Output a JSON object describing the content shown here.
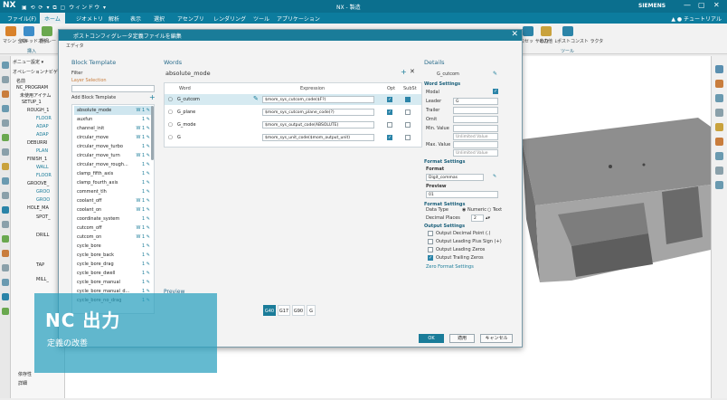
{
  "titlebar": {
    "app": "NX",
    "qat": "▣ ⟲ ⟳ ▾ ⧉ ▢ ウィンドウ ▾",
    "title": "NX - 製造",
    "brand": "SIEMENS",
    "controls": [
      "—",
      "▢",
      "✕"
    ]
  },
  "menubar": {
    "items": [
      "ファイル(F)",
      "ホーム",
      "ジオメトリ",
      "解析",
      "表示",
      "選択",
      "アセンブリ",
      "レンダリング",
      "ツール",
      "アプリケーション"
    ],
    "search": "▲ ● チュートリアル"
  },
  "ribbon": {
    "left": [
      "マシン\n全体",
      "スキッド\n選択",
      "オペレー\nション全体"
    ],
    "group_label": "挿入",
    "right": [
      "プロセッ\nサ出力",
      "その他\n↓",
      "ポストコンスト\nラクタ"
    ],
    "right_group": "ツール"
  },
  "navpanel": {
    "filter": "ボニュー設定 ▾",
    "title": "オペレーションナビゲータ",
    "col": "名前",
    "items": [
      "NC_PROGRAM",
      "未使用アイテム",
      "SETUP_1",
      "ROUGH_1",
      "FLOOR",
      "ADAP",
      "ADAP",
      "DEBURRI",
      "PLAN",
      "FINISH_1",
      "WALL",
      "FLOOR",
      "GROOVE_",
      "GROO",
      "GROO",
      "HOLE_MA",
      "SPOT_",
      "DRILL",
      "TAP",
      "MILL_"
    ],
    "bottom": [
      "依存性",
      "詳細"
    ]
  },
  "dialog": {
    "title": "ポストコンフィグレータ定義ファイルを編集",
    "editor": "エディタ",
    "block_template": {
      "heading": "Block Template",
      "filter_label": "Filter",
      "layer_label": "Layer Selection",
      "add_label": "Add Block Template",
      "items": [
        {
          "name": "absolute_mode",
          "w": "W 1 ✎"
        },
        {
          "name": "auxfun",
          "w": "1 ✎"
        },
        {
          "name": "channel_init",
          "w": "W 1 ✎"
        },
        {
          "name": "circular_move",
          "w": "W 1 ✎"
        },
        {
          "name": "circular_move_turbo",
          "w": "1 ✎"
        },
        {
          "name": "circular_move_turn",
          "w": "W 1 ✎"
        },
        {
          "name": "circular_move_rough...",
          "w": "1 ✎"
        },
        {
          "name": "clamp_fifth_axis",
          "w": "1 ✎"
        },
        {
          "name": "clamp_fourth_axis",
          "w": "1 ✎"
        },
        {
          "name": "comment_tlh",
          "w": "1 ✎"
        },
        {
          "name": "coolant_off",
          "w": "W 1 ✎"
        },
        {
          "name": "coolant_on",
          "w": "W 1 ✎"
        },
        {
          "name": "coordinate_system",
          "w": "1 ✎"
        },
        {
          "name": "cutcom_off",
          "w": "W 1 ✎"
        },
        {
          "name": "cutcom_on",
          "w": "W 1 ✎"
        },
        {
          "name": "cycle_bore",
          "w": "1 ✎"
        },
        {
          "name": "cycle_bore_back",
          "w": "1 ✎"
        },
        {
          "name": "cycle_bore_drag",
          "w": "1 ✎"
        },
        {
          "name": "cycle_bore_dwell",
          "w": "1 ✎"
        },
        {
          "name": "cycle_bore_manual",
          "w": "1 ✎"
        },
        {
          "name": "cycle_bore_manual_d...",
          "w": "1 ✎"
        },
        {
          "name": "cycle_bore_no_drag",
          "w": "1 ✎"
        }
      ]
    },
    "words": {
      "heading": "Words",
      "block_name": "absolute_mode",
      "cols": [
        "Word",
        "Expression",
        "Opt",
        "SubSt"
      ],
      "rows": [
        {
          "word": "G_cutcom",
          "expr": "$mom_sys_cutcom_code($F?)",
          "opt": true,
          "sub": false,
          "sel": true
        },
        {
          "word": "G_plane",
          "expr": "$mom_sys_cutcom_plane_code(?)",
          "opt": true,
          "sub": false,
          "sel": false
        },
        {
          "word": "G_mode",
          "expr": "$mom_sys_output_code(ABSOLUTE)",
          "opt": false,
          "sub": false,
          "sel": false
        },
        {
          "word": "G",
          "expr": "$mom_sys_unit_code($mom_output_unit)",
          "opt": true,
          "sub": false,
          "sel": false
        }
      ],
      "preview_label": "Preview",
      "preview_items": [
        "G40",
        "G17",
        "G90",
        "G"
      ]
    },
    "details": {
      "heading": "Details",
      "name": "G_cutcom",
      "word_settings": "Word Settings",
      "fields": [
        {
          "label": "Modal",
          "value": ""
        },
        {
          "label": "Leader",
          "value": "G"
        },
        {
          "label": "Trailer",
          "value": ""
        },
        {
          "label": "Omit",
          "value": ""
        },
        {
          "label": "Min. Value",
          "value": ""
        },
        {
          "label": "Max. Value",
          "value": ""
        }
      ],
      "unlimited": "Unlimited Value",
      "format_settings": "Format Settings",
      "format_label": "Format",
      "format_value": "Digit_commas",
      "preview_label": "Preview",
      "preview_value": "01",
      "format_settings2": "Format Settings",
      "data_type": "Data Type",
      "numeric": "Numeric",
      "text": "Text",
      "decimal_places": "Decimal Places",
      "dp_value": "2",
      "output_settings": "Output Settings",
      "output_opts": [
        {
          "label": "Output Decimal Point (.)",
          "on": false
        },
        {
          "label": "Output Leading Plus Sign (+)",
          "on": false
        },
        {
          "label": "Output Leading Zeros",
          "on": false
        },
        {
          "label": "Output Trailing Zeros",
          "on": true
        }
      ],
      "zero_format": "Zero Format Settings"
    },
    "buttons": {
      "ok": "OK",
      "apply": "適用",
      "cancel": "キャンセル"
    }
  },
  "overlay": {
    "heading": "NC 出力",
    "sub": "定義の改善"
  },
  "colors": {
    "titlebar": "#0b6f8e",
    "accent": "#1a7c99",
    "overlay": "#28a0be"
  }
}
